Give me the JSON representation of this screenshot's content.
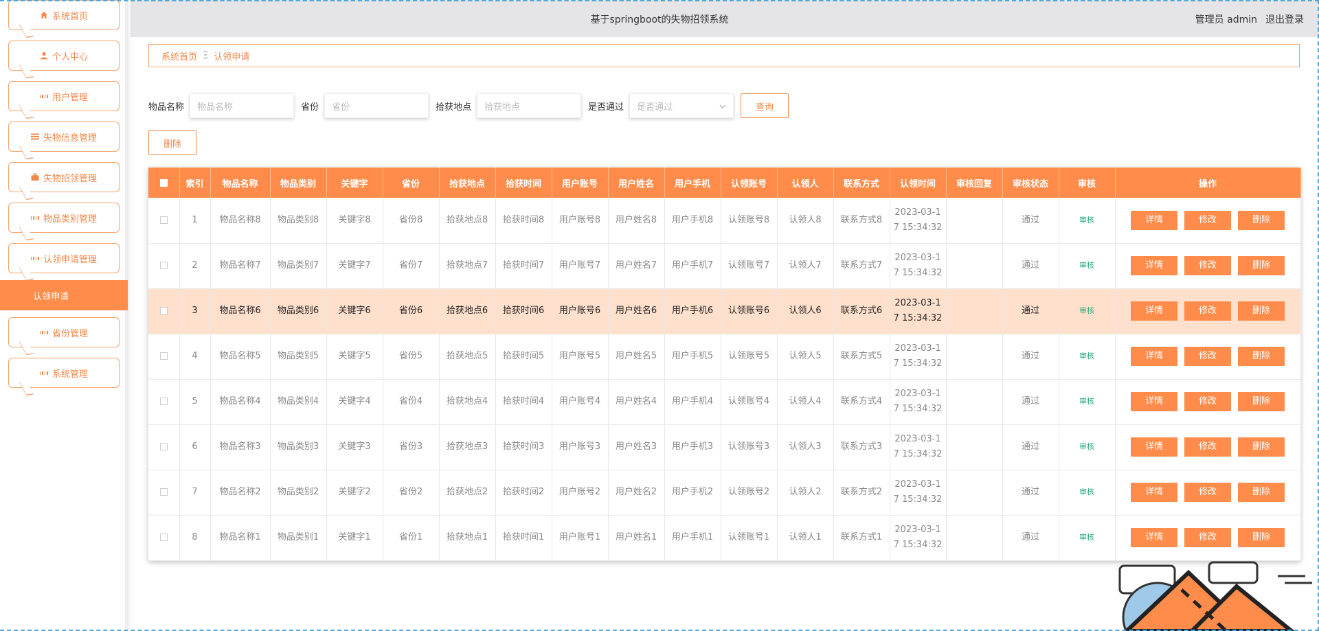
{
  "app": {
    "title": "基于springboot的失物招领系统",
    "user_label": "管理员 admin",
    "logout_label": "退出登录"
  },
  "sidebar": {
    "items": [
      {
        "label": "系统首页",
        "icon": "home-icon"
      },
      {
        "label": "个人中心",
        "icon": "user-icon"
      },
      {
        "label": "用户管理",
        "icon": "grid-icon"
      },
      {
        "label": "失物信息管理",
        "icon": "list-icon"
      },
      {
        "label": "失物招领管理",
        "icon": "briefcase-icon"
      },
      {
        "label": "物品类别管理",
        "icon": "grid-icon"
      },
      {
        "label": "认领申请管理",
        "icon": "grid-icon"
      }
    ],
    "active": {
      "label": "认领申请"
    },
    "items_after": [
      {
        "label": "省份管理",
        "icon": "grid-icon"
      },
      {
        "label": "系统管理",
        "icon": "grid-icon"
      }
    ]
  },
  "breadcrumb": {
    "home": "系统首页",
    "separator": "Ξ",
    "current": "认领申请"
  },
  "search": {
    "name_label": "物品名称",
    "name_placeholder": "物品名称",
    "province_label": "省份",
    "province_placeholder": "省份",
    "place_label": "拾获地点",
    "place_placeholder": "拾获地点",
    "pass_label": "是否通过",
    "pass_placeholder": "是否通过",
    "query_button": "查询"
  },
  "actions": {
    "delete_button": "删除"
  },
  "table": {
    "headers": [
      "索引",
      "物品名称",
      "物品类别",
      "关键字",
      "省份",
      "拾获地点",
      "拾获时间",
      "用户账号",
      "用户姓名",
      "用户手机",
      "认领账号",
      "认领人",
      "联系方式",
      "认领时间",
      "审核回复",
      "审核状态",
      "审核",
      "操作"
    ],
    "rows": [
      {
        "idx": "1",
        "name": "物品名称8",
        "cat": "物品类别8",
        "kw": "关键字8",
        "prov": "省份8",
        "place": "拾获地点8",
        "time": "拾获时间8",
        "acc": "用户账号8",
        "uname": "用户姓名8",
        "phone": "用户手机8",
        "cacc": "认领账号8",
        "claimer": "认领人8",
        "contact": "联系方式8",
        "ctime1": "2023-03-1",
        "ctime2": "7 15:34:32",
        "reply": "",
        "status": "通过",
        "audit": "审核"
      },
      {
        "idx": "2",
        "name": "物品名称7",
        "cat": "物品类别7",
        "kw": "关键字7",
        "prov": "省份7",
        "place": "拾获地点7",
        "time": "拾获时间7",
        "acc": "用户账号7",
        "uname": "用户姓名7",
        "phone": "用户手机7",
        "cacc": "认领账号7",
        "claimer": "认领人7",
        "contact": "联系方式7",
        "ctime1": "2023-03-1",
        "ctime2": "7 15:34:32",
        "reply": "",
        "status": "通过",
        "audit": "审核"
      },
      {
        "idx": "3",
        "name": "物品名称6",
        "cat": "物品类别6",
        "kw": "关键字6",
        "prov": "省份6",
        "place": "拾获地点6",
        "time": "拾获时间6",
        "acc": "用户账号6",
        "uname": "用户姓名6",
        "phone": "用户手机6",
        "cacc": "认领账号6",
        "claimer": "认领人6",
        "contact": "联系方式6",
        "ctime1": "2023-03-1",
        "ctime2": "7 15:34:32",
        "reply": "",
        "status": "通过",
        "audit": "审核"
      },
      {
        "idx": "4",
        "name": "物品名称5",
        "cat": "物品类别5",
        "kw": "关键字5",
        "prov": "省份5",
        "place": "拾获地点5",
        "time": "拾获时间5",
        "acc": "用户账号5",
        "uname": "用户姓名5",
        "phone": "用户手机5",
        "cacc": "认领账号5",
        "claimer": "认领人5",
        "contact": "联系方式5",
        "ctime1": "2023-03-1",
        "ctime2": "7 15:34:32",
        "reply": "",
        "status": "通过",
        "audit": "审核"
      },
      {
        "idx": "5",
        "name": "物品名称4",
        "cat": "物品类别4",
        "kw": "关键字4",
        "prov": "省份4",
        "place": "拾获地点4",
        "time": "拾获时间4",
        "acc": "用户账号4",
        "uname": "用户姓名4",
        "phone": "用户手机4",
        "cacc": "认领账号4",
        "claimer": "认领人4",
        "contact": "联系方式4",
        "ctime1": "2023-03-1",
        "ctime2": "7 15:34:32",
        "reply": "",
        "status": "通过",
        "audit": "审核"
      },
      {
        "idx": "6",
        "name": "物品名称3",
        "cat": "物品类别3",
        "kw": "关键字3",
        "prov": "省份3",
        "place": "拾获地点3",
        "time": "拾获时间3",
        "acc": "用户账号3",
        "uname": "用户姓名3",
        "phone": "用户手机3",
        "cacc": "认领账号3",
        "claimer": "认领人3",
        "contact": "联系方式3",
        "ctime1": "2023-03-1",
        "ctime2": "7 15:34:32",
        "reply": "",
        "status": "通过",
        "audit": "审核"
      },
      {
        "idx": "7",
        "name": "物品名称2",
        "cat": "物品类别2",
        "kw": "关键字2",
        "prov": "省份2",
        "place": "拾获地点2",
        "time": "拾获时间2",
        "acc": "用户账号2",
        "uname": "用户姓名2",
        "phone": "用户手机2",
        "cacc": "认领账号2",
        "claimer": "认领人2",
        "contact": "联系方式2",
        "ctime1": "2023-03-1",
        "ctime2": "7 15:34:32",
        "reply": "",
        "status": "通过",
        "audit": "审核"
      },
      {
        "idx": "8",
        "name": "物品名称1",
        "cat": "物品类别1",
        "kw": "关键字1",
        "prov": "省份1",
        "place": "拾获地点1",
        "time": "拾获时间1",
        "acc": "用户账号1",
        "uname": "用户姓名1",
        "phone": "用户手机1",
        "cacc": "认领账号1",
        "claimer": "认领人1",
        "contact": "联系方式1",
        "ctime1": "2023-03-1",
        "ctime2": "7 15:34:32",
        "reply": "",
        "status": "通过",
        "audit": "审核"
      }
    ],
    "highlight_row": 3,
    "op_labels": {
      "detail": "详情",
      "edit": "修改",
      "delete": "删除"
    }
  },
  "colors": {
    "accent": "#ff8c4a",
    "highlight_row": "#ffe0cc",
    "audit_link": "#2aa87a"
  }
}
